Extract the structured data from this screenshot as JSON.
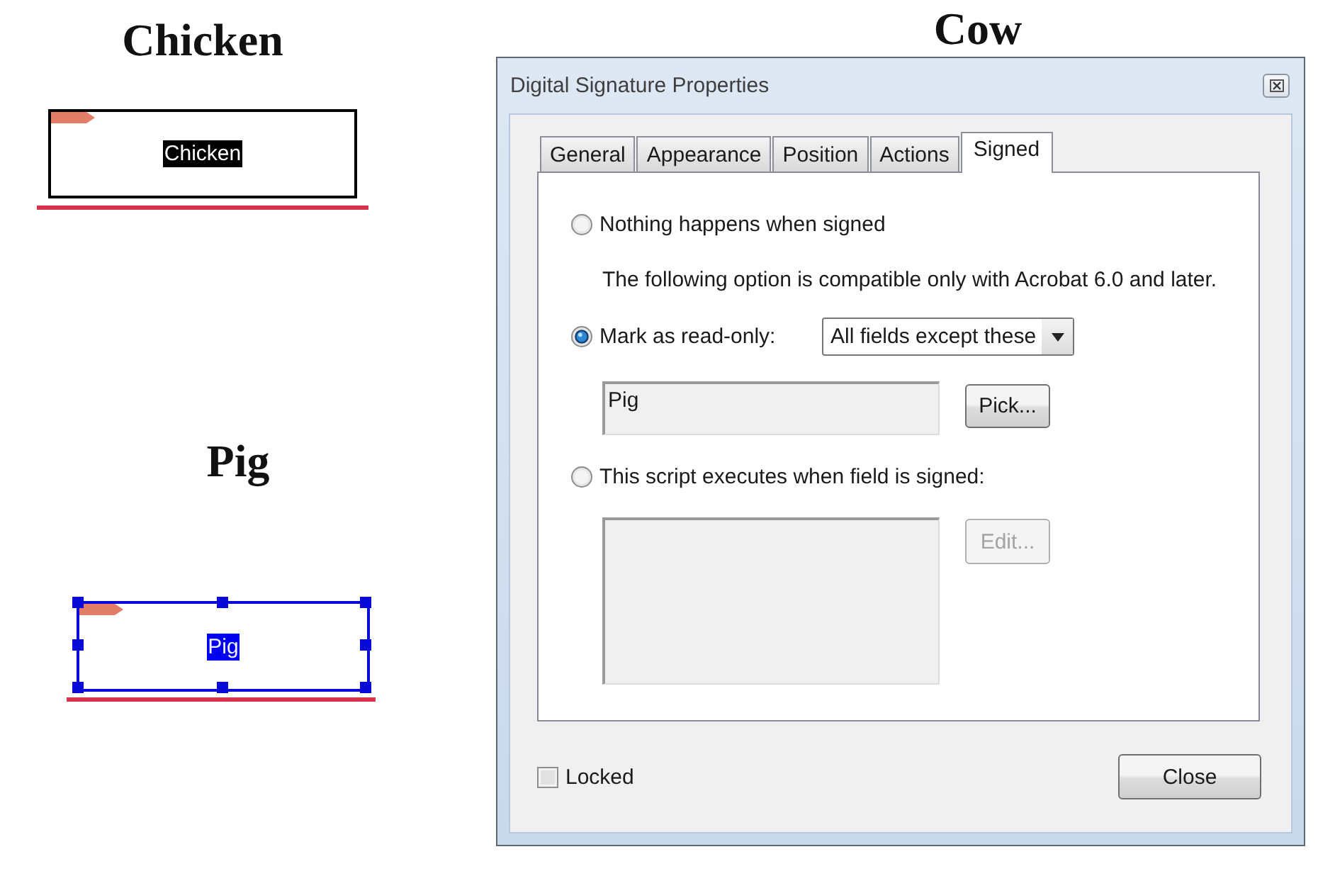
{
  "examples": [
    {
      "heading": "Chicken",
      "field_text": "Chicken",
      "selected": false
    },
    {
      "heading": "Pig",
      "field_text": "Pig",
      "selected": true
    }
  ],
  "dialog_heading": "Cow",
  "dialog": {
    "title": "Digital Signature Properties",
    "tabs": [
      {
        "label": "General",
        "selected": false
      },
      {
        "label": "Appearance",
        "selected": false
      },
      {
        "label": "Position",
        "selected": false
      },
      {
        "label": "Actions",
        "selected": false
      },
      {
        "label": "Signed",
        "selected": true
      }
    ],
    "options": [
      {
        "kind": "plain",
        "label": "Nothing happens when signed",
        "selected": false
      },
      {
        "kind": "field_list",
        "note": "The following option is compatible only with Acrobat 6.0 and later.",
        "label": "Mark as read-only:",
        "selected": true,
        "dropdown": "All fields except these",
        "list_value": "Pig",
        "button": {
          "label": "Pick...",
          "disabled": false
        }
      },
      {
        "kind": "script",
        "label": "This script executes when field is signed:",
        "selected": false,
        "button": {
          "label": "Edit...",
          "disabled": true
        }
      }
    ],
    "locked": {
      "label": "Locked",
      "checked": false
    },
    "close_button": "Close"
  }
}
